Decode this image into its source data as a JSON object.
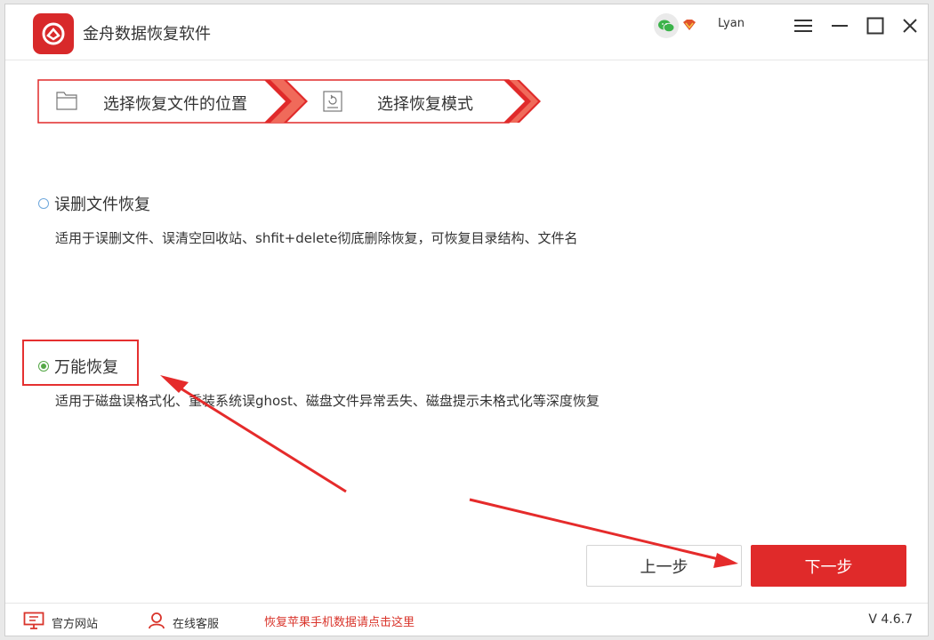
{
  "app": {
    "title": "金舟数据恢复软件",
    "username": "Lyan"
  },
  "steps": [
    {
      "label": "选择恢复文件的位置",
      "icon": "folder-icon"
    },
    {
      "label": "选择恢复模式",
      "icon": "restore-icon"
    }
  ],
  "options": [
    {
      "title": "误删文件恢复",
      "desc": "适用于误删文件、误清空回收站、shfit+delete彻底删除恢复，可恢复目录结构、文件名",
      "checked": false
    },
    {
      "title": "万能恢复",
      "desc": "适用于磁盘误格式化、重装系统误ghost、磁盘文件异常丢失、磁盘提示未格式化等深度恢复",
      "checked": true
    }
  ],
  "buttons": {
    "prev": "上一步",
    "next": "下一步"
  },
  "footer": {
    "website": "官方网站",
    "support": "在线客服",
    "apple_link": "恢复苹果手机数据请点击这里",
    "version": "V 4.6.7"
  },
  "colors": {
    "accent": "#e02a2a",
    "radio_selected": "#55a846",
    "radio_unselected": "#6fa8dc",
    "link": "#d9342b"
  }
}
